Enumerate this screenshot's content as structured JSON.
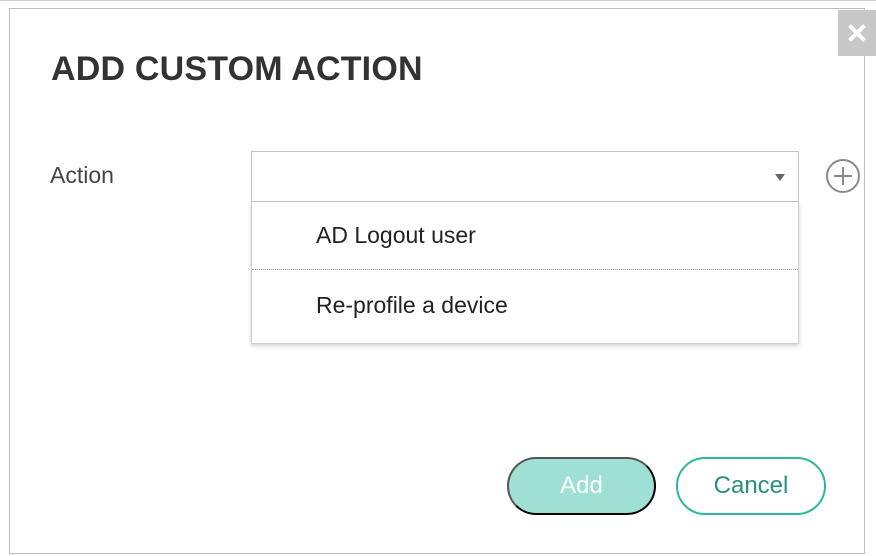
{
  "dialog": {
    "title": "ADD CUSTOM ACTION",
    "close_icon": "close-icon"
  },
  "form": {
    "action_label": "Action",
    "action_value": "",
    "dropdown_icon": "chevron-down-icon",
    "add_icon": "plus-circle-icon",
    "options": [
      "AD Logout user",
      "Re-profile a device"
    ]
  },
  "buttons": {
    "add_label": "Add",
    "cancel_label": "Cancel"
  },
  "colors": {
    "primary_disabled": "#9ee0d4",
    "accent": "#2bb69e",
    "title_text": "#333333",
    "close_background": "#c8c8c8"
  }
}
